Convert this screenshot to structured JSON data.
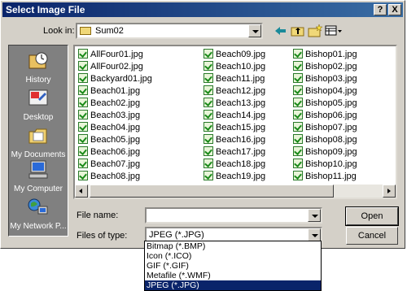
{
  "window": {
    "title": "Select Image File",
    "help_label": "?",
    "close_label": "X"
  },
  "lookin": {
    "label": "Look in:",
    "value": "Sum02"
  },
  "places": [
    {
      "label": "History",
      "icon": "history-icon"
    },
    {
      "label": "Desktop",
      "icon": "desktop-icon"
    },
    {
      "label": "My Documents",
      "icon": "my-documents-icon"
    },
    {
      "label": "My Computer",
      "icon": "my-computer-icon"
    },
    {
      "label": "My Network P...",
      "icon": "my-network-icon"
    }
  ],
  "files": {
    "col1": [
      "AllFour01.jpg",
      "AllFour02.jpg",
      "Backyard01.jpg",
      "Beach01.jpg",
      "Beach02.jpg",
      "Beach03.jpg",
      "Beach04.jpg",
      "Beach05.jpg",
      "Beach06.jpg",
      "Beach07.jpg",
      "Beach08.jpg"
    ],
    "col2": [
      "Beach09.jpg",
      "Beach10.jpg",
      "Beach11.jpg",
      "Beach12.jpg",
      "Beach13.jpg",
      "Beach14.jpg",
      "Beach15.jpg",
      "Beach16.jpg",
      "Beach17.jpg",
      "Beach18.jpg",
      "Beach19.jpg"
    ],
    "col3": [
      "Bishop01.jpg",
      "Bishop02.jpg",
      "Bishop03.jpg",
      "Bishop04.jpg",
      "Bishop05.jpg",
      "Bishop06.jpg",
      "Bishop07.jpg",
      "Bishop08.jpg",
      "Bishop09.jpg",
      "Bishop10.jpg",
      "Bishop11.jpg"
    ]
  },
  "filename": {
    "label": "File name:",
    "value": ""
  },
  "filetype": {
    "label": "Files of type:",
    "value": "JPEG (*.JPG)",
    "options": [
      "Bitmap (*.BMP)",
      "Icon (*.ICO)",
      "GIF (*.GIF)",
      "Metafile (*.WMF)",
      "JPEG (*.JPG)"
    ]
  },
  "buttons": {
    "open": "Open",
    "cancel": "Cancel"
  },
  "colors": {
    "titlebar": "#0a246a",
    "face": "#d4d0c8",
    "selection": "#0a246a"
  }
}
